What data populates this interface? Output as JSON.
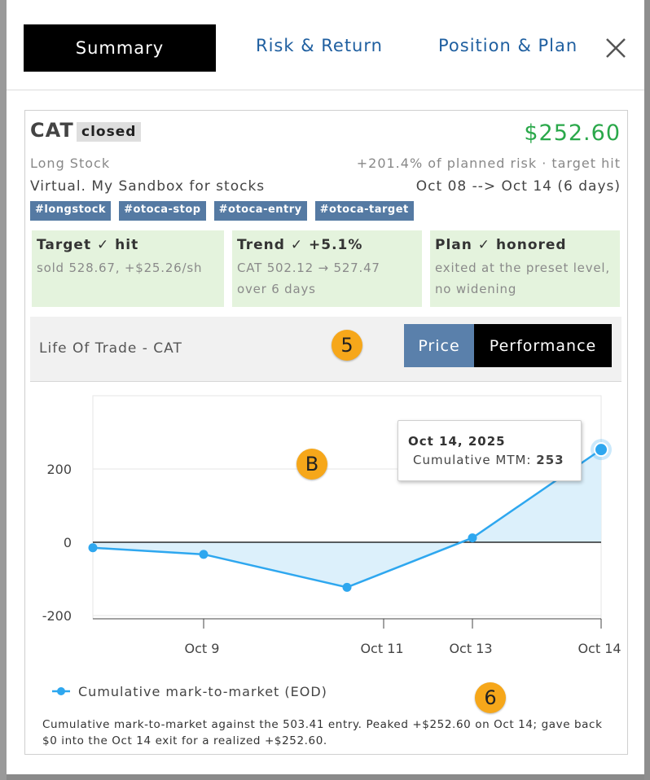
{
  "tabs": {
    "summary": "Summary",
    "risk_return": "Risk & Return",
    "position_plan": "Position & Plan"
  },
  "trade": {
    "ticker": "CAT",
    "status": "closed",
    "pnl": "$252.60",
    "type": "Long Stock",
    "risk_summary": "+201.4% of planned risk · target hit",
    "account": "Virtual. My Sandbox for stocks",
    "dates": "Oct 08 --> Oct 14 (6 days)",
    "tags": [
      "#longstock",
      "#otoca-stop",
      "#otoca-entry",
      "#otoca-target"
    ]
  },
  "summary_boxes": [
    {
      "title": "Target ✓ hit",
      "line1": "sold 528.67, +$25.26/sh",
      "line2": ""
    },
    {
      "title": "Trend ✓ +5.1%",
      "line1": "CAT 502.12 → 527.47",
      "line2": "over 6 days"
    },
    {
      "title": "Plan ✓ honored",
      "line1": "exited at the preset level,",
      "line2": "no widening"
    }
  ],
  "life_of_trade": {
    "title": "Life Of Trade - CAT",
    "price_label": "Price",
    "performance_label": "Performance"
  },
  "markers": {
    "five": "5",
    "b": "B",
    "six": "6"
  },
  "tooltip": {
    "date": "Oct 14, 2025",
    "label": "Cumulative MTM:",
    "value": "253"
  },
  "legend": {
    "series": "Cumulative mark-to-market (EOD)"
  },
  "caption": "Cumulative mark-to-market against the 503.41 entry. Peaked +$252.60 on Oct 14; gave back $0 into the Oct 14 exit for a realized +$252.60.",
  "colors": {
    "series": "#2ea7ef",
    "fill": "#dcf0fb",
    "pnl": "#2aa84a",
    "tag": "#557aa3"
  },
  "chart_data": {
    "type": "area",
    "title": "",
    "xlabel": "",
    "ylabel": "",
    "x_ticks": [
      "Oct 9",
      "Oct 11",
      "Oct 13",
      "Oct 14"
    ],
    "y_ticks": [
      200,
      0,
      -200
    ],
    "ylim": [
      -200,
      250
    ],
    "grid": true,
    "series": [
      {
        "name": "Cumulative mark-to-market (EOD)",
        "x": [
          "Oct 8",
          "Oct 9",
          "Oct 10",
          "Oct 13",
          "Oct 14"
        ],
        "values": [
          -15,
          -33,
          -123,
          12,
          253
        ]
      }
    ]
  }
}
